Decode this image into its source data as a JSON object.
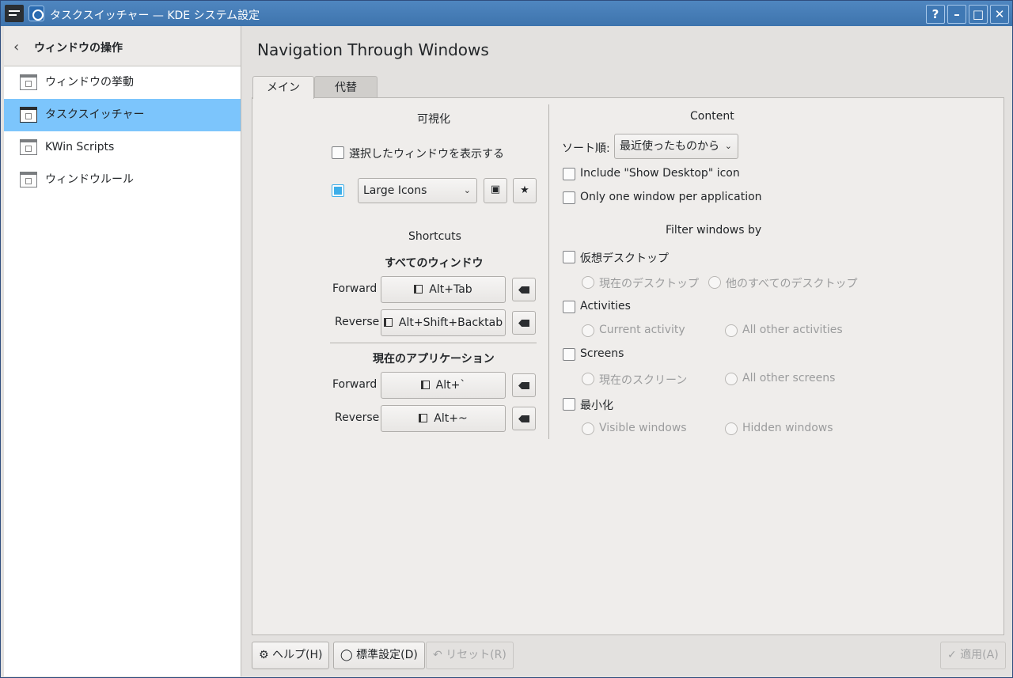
{
  "window": {
    "title": "タスクスイッチャー — KDE システム設定"
  },
  "titlebar_buttons": {
    "help": "?",
    "minimize": "–",
    "maximize": "□",
    "close": "✕"
  },
  "sidebar": {
    "header": "ウィンドウの操作",
    "items": [
      {
        "label": "ウィンドウの挙動",
        "selected": false
      },
      {
        "label": "タスクスイッチャー",
        "selected": true
      },
      {
        "label": "KWin Scripts",
        "selected": false
      },
      {
        "label": "ウィンドウルール",
        "selected": false
      }
    ]
  },
  "page": {
    "title": "Navigation Through Windows"
  },
  "tabs": [
    "メイン",
    "代替"
  ],
  "visualization": {
    "heading": "可視化",
    "show_selected_window_label": "選択したウィンドウを表示する",
    "show_selected_window_checked": false,
    "effect_enabled": true,
    "effect_value": "Large Icons"
  },
  "shortcuts": {
    "heading": "Shortcuts",
    "all_windows_heading": "すべてのウィンドウ",
    "current_app_heading": "現在のアプリケーション",
    "forward_label": "Forward",
    "reverse_label": "Reverse",
    "all_forward": "Alt+Tab",
    "all_reverse": "Alt+Shift+Backtab",
    "app_forward": "Alt+`",
    "app_reverse": "Alt+~"
  },
  "content": {
    "heading": "Content",
    "sort_label": "ソート順:",
    "sort_value": "最近使ったものから",
    "include_desktop_label": "Include \"Show Desktop\" icon",
    "one_window_label": "Only one window per application"
  },
  "filter": {
    "heading": "Filter windows by",
    "virtual_desktop": {
      "label": "仮想デスクトップ",
      "opt1": "現在のデスクトップ",
      "opt2": "他のすべてのデスクトップ"
    },
    "activities": {
      "label": "Activities",
      "opt1": "Current activity",
      "opt2": "All other activities"
    },
    "screens": {
      "label": "Screens",
      "opt1": "現在のスクリーン",
      "opt2": "All other screens"
    },
    "minimized": {
      "label": "最小化",
      "opt1": "Visible windows",
      "opt2": "Hidden windows"
    }
  },
  "footer": {
    "help": "ヘルプ(H)",
    "defaults": "標準設定(D)",
    "reset": "リセット(R)",
    "apply": "適用(A)"
  },
  "colors": {
    "titlebar": "#4181c1",
    "selection": "#7cc5fc",
    "accent": "#3daee9"
  }
}
